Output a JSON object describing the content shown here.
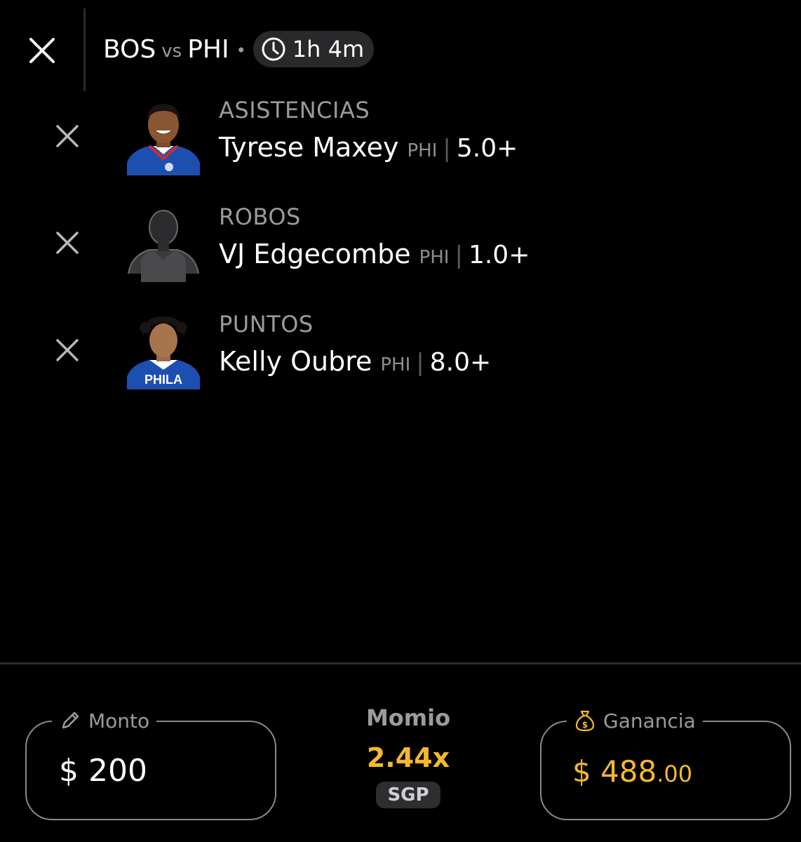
{
  "header": {
    "home_team": "BOS",
    "vs_label": "vs",
    "away_team": "PHI",
    "separator": "•",
    "time_remaining": "1h 4m"
  },
  "legs": [
    {
      "market": "ASISTENCIAS",
      "player": "Tyrese Maxey",
      "team": "PHI",
      "divider": "|",
      "line": "5.0+",
      "avatar_type": "photo",
      "jersey_color": "#1d4fb0"
    },
    {
      "market": "ROBOS",
      "player": "VJ Edgecombe",
      "team": "PHI",
      "divider": "|",
      "line": "1.0+",
      "avatar_type": "silhouette",
      "jersey_color": "#3a3a3c"
    },
    {
      "market": "PUNTOS",
      "player": "Kelly Oubre",
      "team": "PHI",
      "divider": "|",
      "line": "8.0+",
      "avatar_type": "photo",
      "jersey_color": "#1d4fb0",
      "jersey_text": "PHILA"
    }
  ],
  "bet_slip": {
    "stake_label": "Monto",
    "stake_value": "$ 200",
    "odds_label": "Momio",
    "odds_value": "2.44x",
    "bet_type": "SGP",
    "payout_label": "Ganancia",
    "payout_main": "$ 488",
    "payout_cents": ".00"
  },
  "colors": {
    "background": "#000000",
    "accent_gold": "#f5b82e",
    "muted_text": "#9b9b9f"
  },
  "icons": {
    "close": "close-icon",
    "clock": "clock-icon",
    "pencil": "pencil-icon",
    "money_bag": "money-bag-icon"
  }
}
